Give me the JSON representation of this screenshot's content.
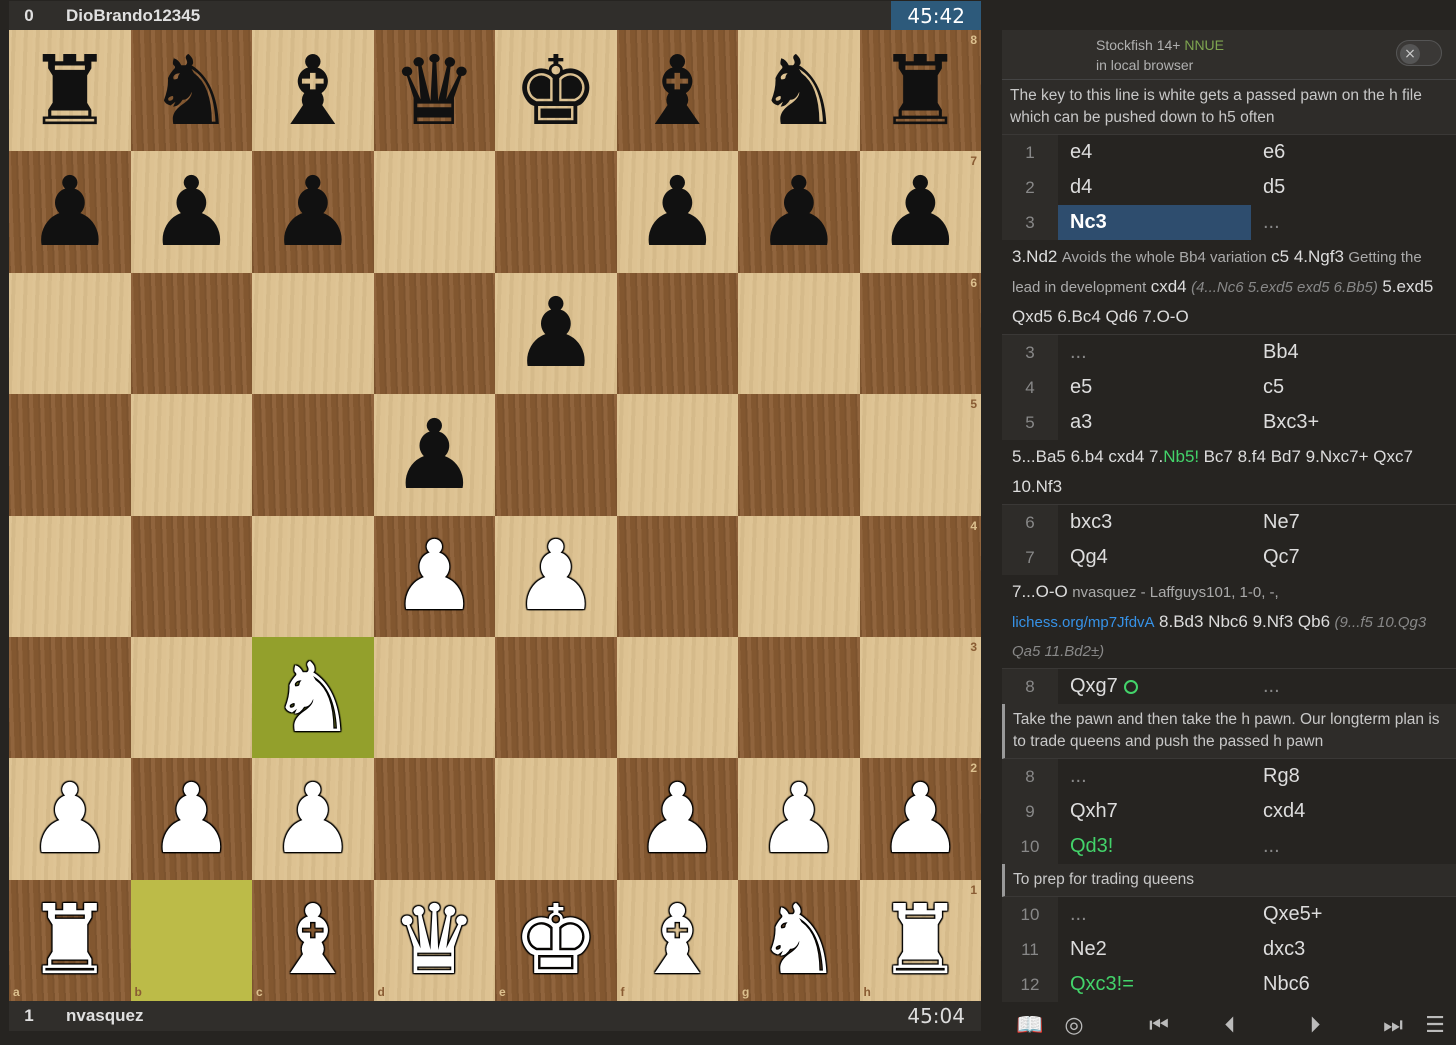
{
  "top_player": {
    "score": "0",
    "name": "DioBrando12345",
    "clock": "45:42"
  },
  "bottom_player": {
    "score": "1",
    "name": "nvasquez",
    "clock": "45:04"
  },
  "board": {
    "ranks": [
      "8",
      "7",
      "6",
      "5",
      "4",
      "3",
      "2",
      "1"
    ],
    "files": [
      "a",
      "b",
      "c",
      "d",
      "e",
      "f",
      "g",
      "h"
    ],
    "position": [
      [
        "bR",
        "bN",
        "bB",
        "bQ",
        "bK",
        "bB",
        "bN",
        "bR"
      ],
      [
        "bP",
        "bP",
        "bP",
        "",
        "",
        "bP",
        "bP",
        "bP"
      ],
      [
        "",
        "",
        "",
        "",
        "bP",
        "",
        "",
        ""
      ],
      [
        "",
        "",
        "",
        "bP",
        "",
        "",
        "",
        ""
      ],
      [
        "",
        "",
        "",
        "wP",
        "wP",
        "",
        "",
        ""
      ],
      [
        "",
        "",
        "wN",
        "",
        "",
        "",
        "",
        ""
      ],
      [
        "wP",
        "wP",
        "wP",
        "",
        "",
        "wP",
        "wP",
        "wP"
      ],
      [
        "wR",
        "",
        "wB",
        "wQ",
        "wK",
        "wB",
        "wN",
        "wR"
      ]
    ],
    "last_move_to": "c3",
    "last_move_from": "b1",
    "glyphs": {
      "K": "♚",
      "Q": "♛",
      "R": "♜",
      "B": "♝",
      "N": "♞",
      "P": "♟"
    }
  },
  "engine": {
    "name": "Stockfish 14+",
    "tag": "NNUE",
    "location": "in local browser",
    "toggle_icon": "×"
  },
  "comment1": "The key to this line is white gets a passed pawn on the h file which can be pushed down to h5 often",
  "moves_a": [
    {
      "n": "1",
      "w": "e4",
      "b": "e6"
    },
    {
      "n": "2",
      "w": "d4",
      "b": "d5"
    },
    {
      "n": "3",
      "w": "Nc3",
      "b": "..."
    }
  ],
  "var1": {
    "m1": "3.Nd2",
    "c1": "Avoids the whole Bb4 variation",
    "m2": "c5 4.Ngf3",
    "c2": "Getting the lead in development",
    "m3": "cxd4",
    "i1": "(4...Nc6 5.exd5 exd5 6.Bb5)",
    "m4": "5.exd5 Qxd5 6.Bc4 Qd6 7.O-O"
  },
  "moves_b": [
    {
      "n": "3",
      "w": "...",
      "b": "Bb4"
    },
    {
      "n": "4",
      "w": "e5",
      "b": "c5"
    },
    {
      "n": "5",
      "w": "a3",
      "b": "Bxc3+"
    }
  ],
  "var2": {
    "m1": "5...Ba5 6.b4 cxd4 7.",
    "g1": "Nb5!",
    "m2": "Bc7 8.f4 Bd7 9.Nxc7+ Qxc7 10.Nf3"
  },
  "moves_c": [
    {
      "n": "6",
      "w": "bxc3",
      "b": "Ne7"
    },
    {
      "n": "7",
      "w": "Qg4",
      "b": "Qc7"
    }
  ],
  "var3": {
    "m1": "7...O-O",
    "c1": "nvasquez - Laffguys101, 1-0, -,",
    "link": "lichess.org/mp7JfdvA",
    "m2": "8.Bd3 Nbc6 9.Nf3 Qb6",
    "i1": "(9...f5 10.Qg3 Qa5 11.Bd2±)"
  },
  "move8": {
    "n": "8",
    "w": "Qxg7",
    "b": "..."
  },
  "comment2": "Take the pawn and then take the h pawn. Our longterm plan is to trade queens and push the passed h pawn",
  "moves_d": [
    {
      "n": "8",
      "w": "...",
      "b": "Rg8"
    },
    {
      "n": "9",
      "w": "Qxh7",
      "b": "cxd4"
    }
  ],
  "move10": {
    "n": "10",
    "w": "Qd3!",
    "b": "..."
  },
  "comment3": "To prep for trading queens",
  "moves_e": [
    {
      "n": "10",
      "w": "...",
      "b": "Qxe5+"
    },
    {
      "n": "11",
      "w": "Ne2",
      "b": "dxc3"
    }
  ],
  "move12": {
    "n": "12",
    "w": "Qxc3!=",
    "b": "Nbc6"
  },
  "controls": {
    "book": "📖",
    "target": "◎",
    "first": "⏮",
    "prev": "⏴",
    "next": "⏵",
    "last": "⏭",
    "menu": "☰"
  }
}
